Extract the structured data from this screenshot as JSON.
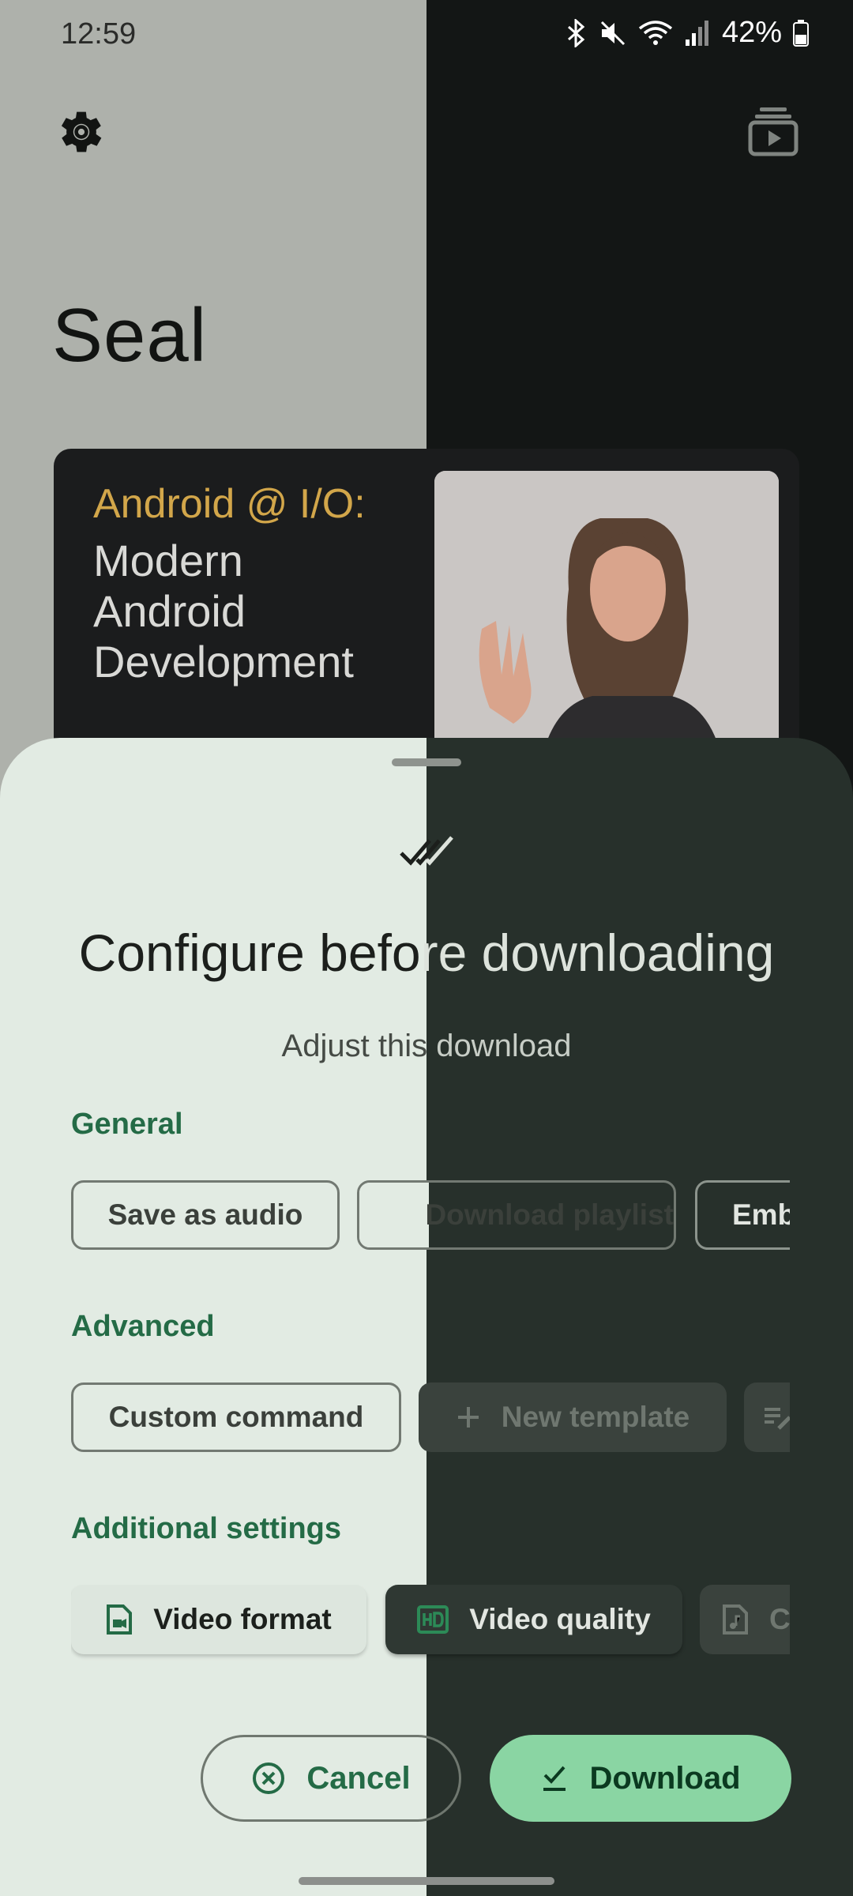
{
  "status_bar": {
    "time": "12:59",
    "battery": "42%"
  },
  "app": {
    "title": "Seal"
  },
  "video": {
    "badge": "Android @ I/O:",
    "headline_lines": [
      "Modern",
      "Android",
      "Development"
    ]
  },
  "sheet": {
    "title_left": "Configure befo",
    "title_right": "re downloading",
    "subtitle_left": "Adjust this",
    "subtitle_right": " download",
    "general": {
      "label": "General",
      "chips": [
        "Save as audio",
        "Download playlist",
        "Emb"
      ]
    },
    "advanced": {
      "label": "Advanced",
      "chips": [
        "Custom command",
        "New template"
      ]
    },
    "additional": {
      "label": "Additional settings",
      "chips": [
        "Video format",
        "Video quality",
        "C"
      ]
    },
    "cancel_label": "Cancel",
    "download_label": "Download"
  },
  "colors": {
    "accent": "#246b46",
    "download_bg": "#8ad5a3",
    "badge": "#d2a64a"
  },
  "icons": [
    "gear-icon",
    "queue-play-icon",
    "done-all-icon",
    "plus-icon",
    "list-edit-icon",
    "video-file-icon",
    "hd-icon",
    "audio-file-icon",
    "cancel-circle-icon",
    "download-check-icon"
  ]
}
